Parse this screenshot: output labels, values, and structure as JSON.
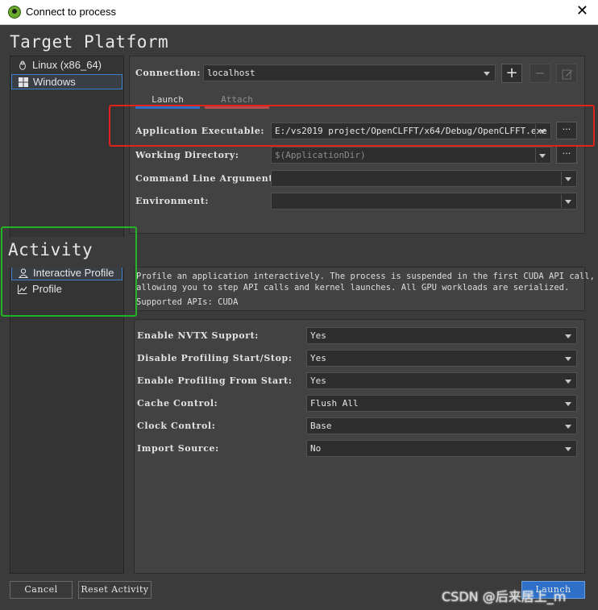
{
  "window": {
    "title": "Connect to process",
    "close_icon": "close-icon"
  },
  "target_platform": {
    "heading": "Target Platform",
    "items": [
      {
        "label": "Linux (x86_64)",
        "icon": "linux-icon"
      },
      {
        "label": "Windows",
        "icon": "windows-icon",
        "selected": true
      }
    ]
  },
  "connection": {
    "label": "Connection:",
    "value": "localhost"
  },
  "tabs": [
    {
      "label": "Launch",
      "active": true,
      "accent": "#2e70c8"
    },
    {
      "label": "Attach",
      "active": false,
      "accent": "#b74a4a"
    }
  ],
  "launch": {
    "app_exe_label": "Application Executable:",
    "app_exe_value": "E:/vs2019 project/OpenCLFFT/x64/Debug/OpenCLFFT.exe",
    "workdir_label": "Working Directory:",
    "workdir_value": "$(ApplicationDir)",
    "args_label": "Command Line Arguments:",
    "args_value": "",
    "env_label": "Environment:",
    "env_value": ""
  },
  "browse_label": "···",
  "activity": {
    "heading": "Activity",
    "items": [
      {
        "label": "Interactive Profile",
        "icon": "person-icon",
        "selected": true
      },
      {
        "label": "Profile",
        "icon": "chart-icon"
      }
    ]
  },
  "description": {
    "line1": "Profile an application interactively. The process is suspended in the first CUDA API call,",
    "line2": "allowing you to step API calls and kernel launches. All GPU workloads are serialized.",
    "line3": "Supported APIs: CUDA"
  },
  "options": [
    {
      "label": "Enable NVTX Support:",
      "value": "Yes"
    },
    {
      "label": "Disable Profiling Start/Stop:",
      "value": "Yes"
    },
    {
      "label": "Enable Profiling From Start:",
      "value": "Yes"
    },
    {
      "label": "Cache Control:",
      "value": "Flush All"
    },
    {
      "label": "Clock Control:",
      "value": "Base"
    },
    {
      "label": "Import Source:",
      "value": "No"
    }
  ],
  "footer": {
    "cancel": "Cancel",
    "reset": "Reset Activity",
    "launch": "Launch"
  },
  "watermark": "CSDN @后来居上_m",
  "annotation_colors": {
    "red_box": "#e0241b",
    "green_box": "#22b422"
  }
}
